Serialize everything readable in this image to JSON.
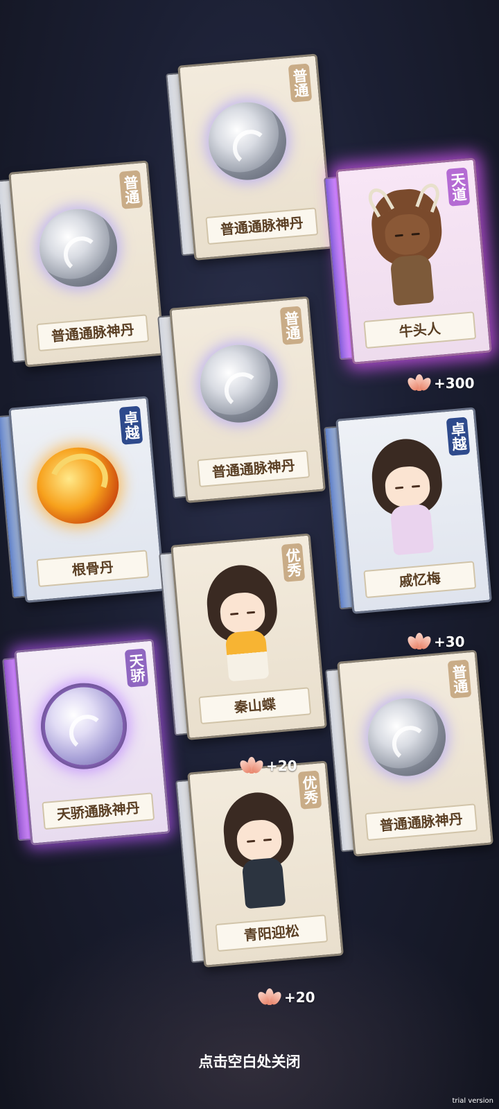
{
  "cards": [
    {
      "tier": "普通",
      "name": "普通通脉神丹"
    },
    {
      "tier": "普通",
      "name": "普通通脉神丹"
    },
    {
      "tier": "天道",
      "name": "牛头人"
    },
    {
      "tier": "普通",
      "name": "普通通脉神丹"
    },
    {
      "tier": "卓越",
      "name": "根骨丹"
    },
    {
      "tier": "卓越",
      "name": "戚忆梅"
    },
    {
      "tier": "优秀",
      "name": "秦山蝶"
    },
    {
      "tier": "天骄",
      "name": "天骄通脉神丹"
    },
    {
      "tier": "普通",
      "name": "普通通脉神丹"
    },
    {
      "tier": "优秀",
      "name": "青阳迎松"
    }
  ],
  "rewards": [
    "+300",
    "+30",
    "+20",
    "+20"
  ],
  "close_hint": "点击空白处关闭",
  "watermark": "trial version",
  "colors": {
    "background": "#1b1f33",
    "badge_common": "#c9ac87",
    "badge_superb": "#2e4a8c",
    "badge_prodigy": "#8f66c0",
    "badge_heaven": "#b46bd3",
    "glow_purple": "#be5aff"
  }
}
